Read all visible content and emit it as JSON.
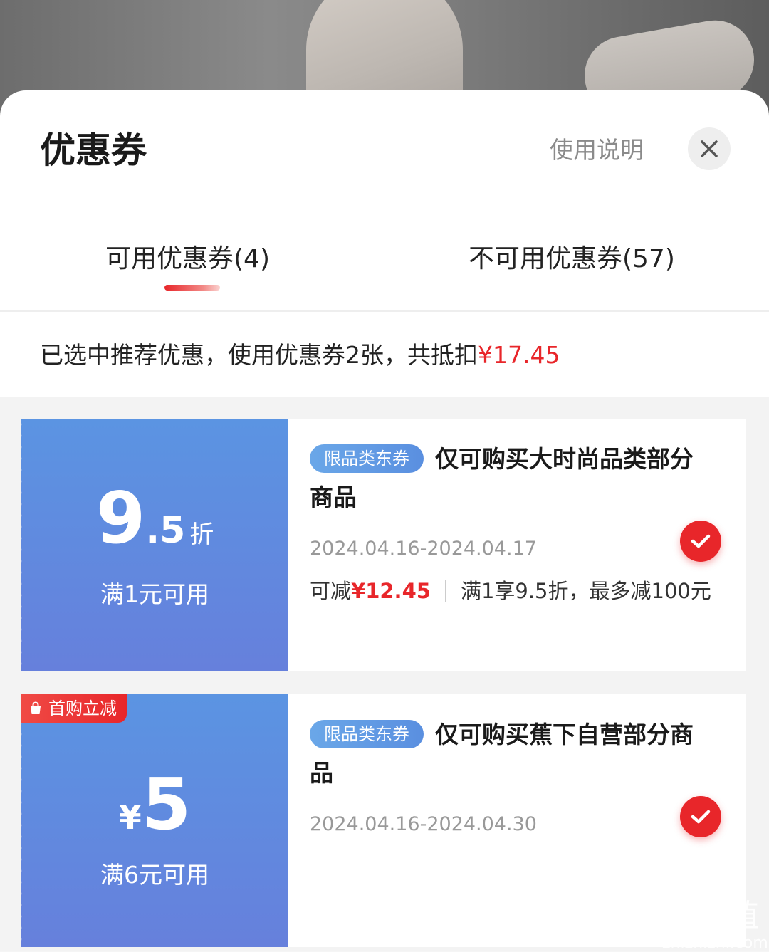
{
  "header": {
    "title": "优惠券",
    "usage_link": "使用说明"
  },
  "tabs": [
    {
      "label": "可用优惠券(4)",
      "active": true
    },
    {
      "label": "不可用优惠券(57)",
      "active": false
    }
  ],
  "summary": {
    "text": "已选中推荐优惠，使用优惠券2张，共抵扣",
    "amount": "¥17.45"
  },
  "coupons": [
    {
      "value_int": "9",
      "value_dec": ".5",
      "value_unit": "折",
      "threshold": "满1元可用",
      "tag": "限品类东券",
      "title": "仅可购买大时尚品类部分商品",
      "date": "2024.04.16-2024.04.17",
      "savings_prefix": "可减",
      "savings_amount": "¥12.45",
      "rule": "满1享9.5折，最多减100元",
      "selected": true
    },
    {
      "badge": "首购立减",
      "currency": "¥",
      "value": "5",
      "threshold": "满6元可用",
      "tag": "限品类东券",
      "title": "仅可购买蕉下自营部分商品",
      "date": "2024.04.16-2024.04.30",
      "selected": true
    }
  ],
  "watermark": {
    "glyphs": "值值值",
    "domain": "zhizhizhi.com"
  },
  "colors": {
    "accent_red": "#e8262a",
    "coupon_blue_top": "#5b94e2",
    "coupon_blue_bottom": "#6680dc"
  }
}
